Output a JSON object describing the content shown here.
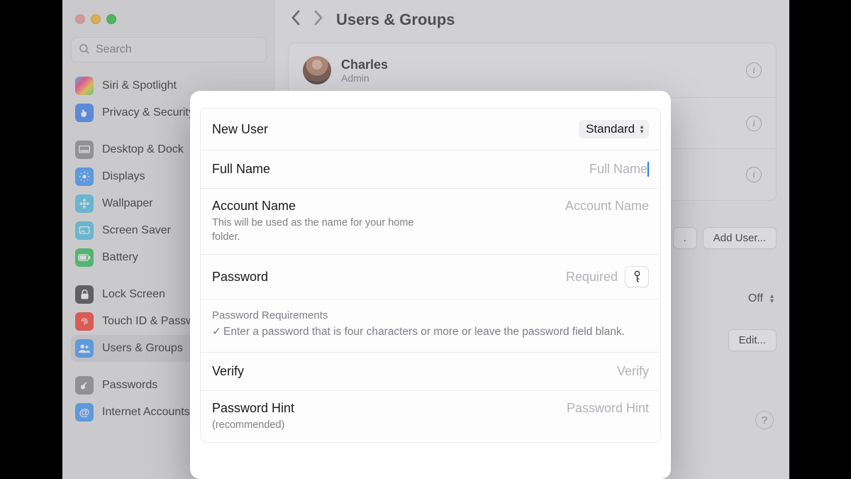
{
  "header": {
    "title": "Users & Groups"
  },
  "search": {
    "placeholder": "Search"
  },
  "sidebar": {
    "items": [
      {
        "label": "Siri & Spotlight",
        "iconClass": "ic-siri"
      },
      {
        "label": "Privacy & Security",
        "iconClass": "ic-privacy"
      },
      {
        "label": "Desktop & Dock",
        "iconClass": "ic-desktop"
      },
      {
        "label": "Displays",
        "iconClass": "ic-displays"
      },
      {
        "label": "Wallpaper",
        "iconClass": "ic-wallpaper"
      },
      {
        "label": "Screen Saver",
        "iconClass": "ic-screensaver"
      },
      {
        "label": "Battery",
        "iconClass": "ic-battery"
      },
      {
        "label": "Lock Screen",
        "iconClass": "ic-lock"
      },
      {
        "label": "Touch ID & Password",
        "iconClass": "ic-touchid"
      },
      {
        "label": "Users & Groups",
        "iconClass": "ic-users"
      },
      {
        "label": "Passwords",
        "iconClass": "ic-passwords"
      },
      {
        "label": "Internet Accounts",
        "iconClass": "ic-internet"
      }
    ]
  },
  "main": {
    "user_name": "Charles",
    "user_role": "Admin",
    "add_user_label": "Add User...",
    "toggle_label": "Off",
    "edit_label": "Edit..."
  },
  "modal": {
    "new_user_label": "New User",
    "new_user_type": "Standard",
    "full_name_label": "Full Name",
    "full_name_placeholder": "Full Name",
    "account_name_label": "Account Name",
    "account_name_sub": "This will be used as the name for your home folder.",
    "account_name_placeholder": "Account Name",
    "password_label": "Password",
    "password_placeholder": "Required",
    "requirements_title": "Password Requirements",
    "requirements_text": "Enter a password that is four characters or more or leave the password field blank.",
    "verify_label": "Verify",
    "verify_placeholder": "Verify",
    "hint_label": "Password Hint",
    "hint_sub": "(recommended)",
    "hint_placeholder": "Password Hint"
  }
}
